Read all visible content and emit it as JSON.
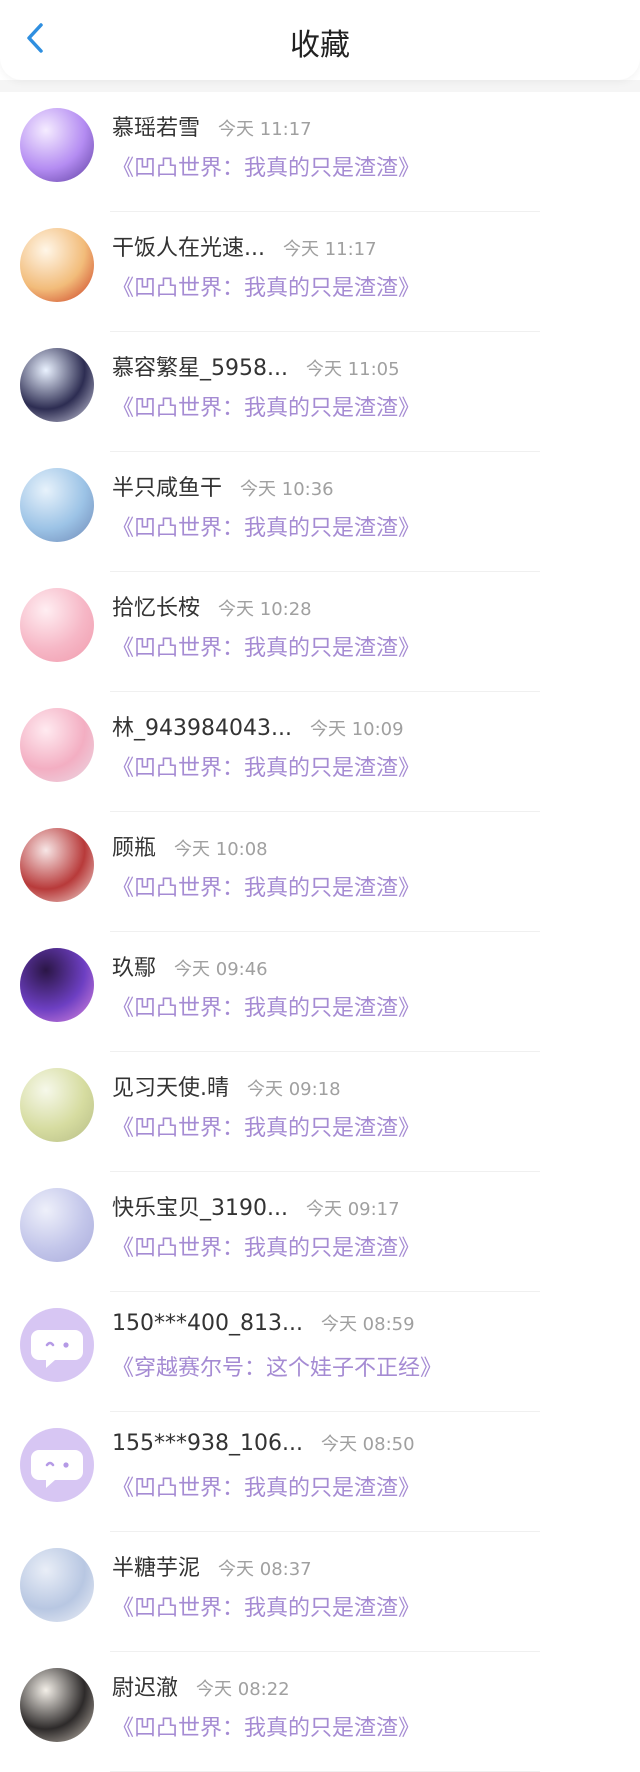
{
  "header": {
    "title": "收藏",
    "back_icon": "chevron-left-icon"
  },
  "items": [
    {
      "name": "慕瑶若雪",
      "time": "今天 11:17",
      "book": "《凹凸世界：我真的只是渣渣》",
      "avatar": {
        "colors": [
          "#f5ecff",
          "#b48cf2",
          "#5a3b9c"
        ]
      }
    },
    {
      "name": "干饭人在光速...",
      "time": "今天 11:17",
      "book": "《凹凸世界：我真的只是渣渣》",
      "avatar": {
        "colors": [
          "#fff6e8",
          "#f2bc7a",
          "#c9361e"
        ]
      }
    },
    {
      "name": "慕容繁星_5958...",
      "time": "今天 11:05",
      "book": "《凹凸世界：我真的只是渣渣》",
      "avatar": {
        "colors": [
          "#eaf2ff",
          "#2d2d52",
          "#d8d8e8"
        ]
      }
    },
    {
      "name": "半只咸鱼干",
      "time": "今天 10:36",
      "book": "《凹凸世界：我真的只是渣渣》",
      "avatar": {
        "colors": [
          "#e7f2fb",
          "#9cc3e6",
          "#6c86b4"
        ]
      }
    },
    {
      "name": "拾忆长桉",
      "time": "今天 10:28",
      "book": "《凹凸世界：我真的只是渣渣》",
      "avatar": {
        "colors": [
          "#ffeef2",
          "#f6b7c6",
          "#f09aac"
        ]
      }
    },
    {
      "name": "林_943984043...",
      "time": "今天 10:09",
      "book": "《凹凸世界：我真的只是渣渣》",
      "avatar": {
        "colors": [
          "#ffeaf0",
          "#f3aec2",
          "#eadbe6"
        ]
      }
    },
    {
      "name": "顾瓶",
      "time": "今天 10:08",
      "book": "《凹凸世界：我真的只是渣渣》",
      "avatar": {
        "colors": [
          "#f7e6e6",
          "#b83a3a",
          "#f4e4df"
        ]
      }
    },
    {
      "name": "玖鄢",
      "time": "今天 09:46",
      "book": "《凹凸世界：我真的只是渣渣》",
      "avatar": {
        "colors": [
          "#2b1646",
          "#6d3fc2",
          "#e08be0"
        ]
      }
    },
    {
      "name": "见习天使.晴",
      "time": "今天 09:18",
      "book": "《凹凸世界：我真的只是渣渣》",
      "avatar": {
        "colors": [
          "#f6f8ea",
          "#d6dca0",
          "#b5bb85"
        ]
      }
    },
    {
      "name": "快乐宝贝_3190...",
      "time": "今天 09:17",
      "book": "《凹凸世界：我真的只是渣渣》",
      "avatar": {
        "colors": [
          "#eef0fa",
          "#c3c6ea",
          "#a9abdb"
        ]
      }
    },
    {
      "name": "150***400_813...",
      "time": "今天 08:59",
      "book": "《穿越赛尔号：这个娃子不正经》",
      "avatar": {
        "default": true,
        "colors": [
          "#d7c6f3",
          "#ffffff",
          "#b59ae6"
        ]
      }
    },
    {
      "name": "155***938_106...",
      "time": "今天 08:50",
      "book": "《凹凸世界：我真的只是渣渣》",
      "avatar": {
        "default": true,
        "colors": [
          "#d7c6f3",
          "#ffffff",
          "#b59ae6"
        ]
      }
    },
    {
      "name": "半糖芋泥",
      "time": "今天 08:37",
      "book": "《凹凸世界：我真的只是渣渣》",
      "avatar": {
        "colors": [
          "#e9eef7",
          "#b8c7e2",
          "#f0f2f8"
        ]
      }
    },
    {
      "name": "尉迟澈",
      "time": "今天 08:22",
      "book": "《凹凸世界：我真的只是渣渣》",
      "avatar": {
        "colors": [
          "#f3efe8",
          "#2d2a2a",
          "#cfc6bb"
        ]
      }
    }
  ]
}
